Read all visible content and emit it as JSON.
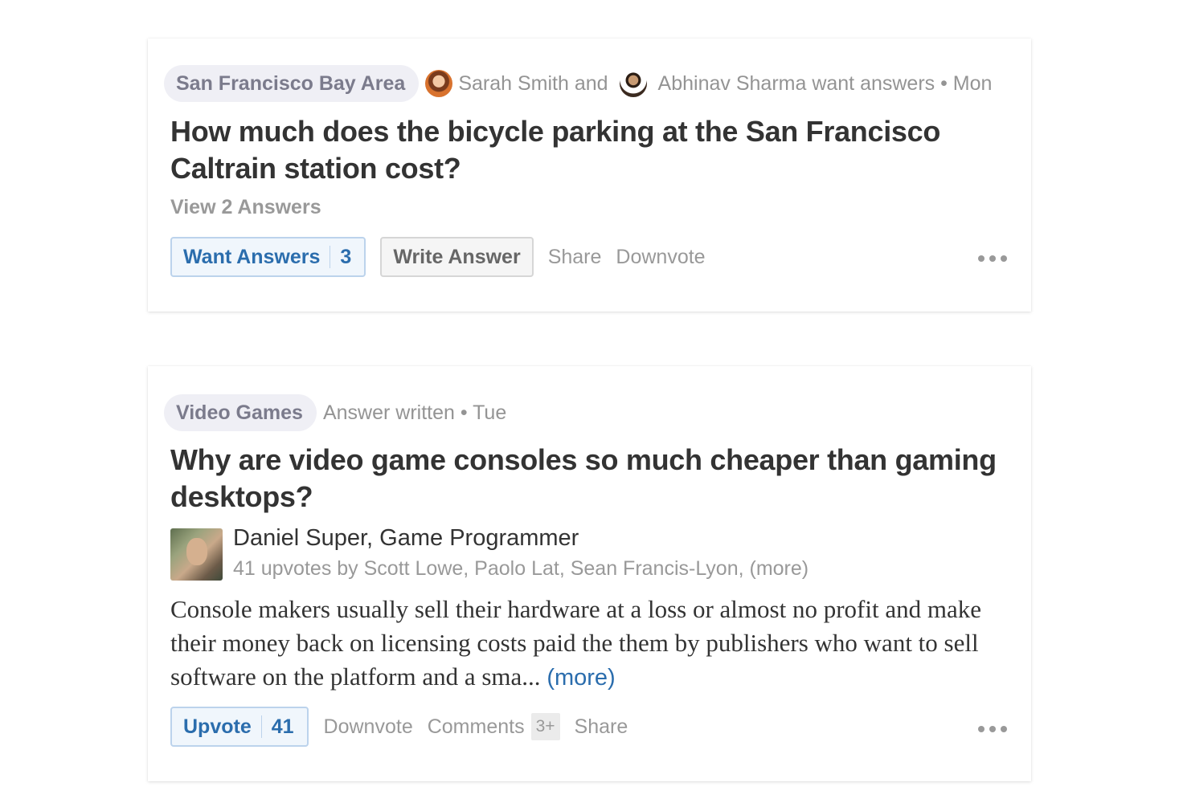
{
  "feed": {
    "question_card": {
      "topic": "San Francisco Bay Area",
      "asker_1": "Sarah Smith and",
      "asker_2_text": "Abhinav Sharma want answers • Mon",
      "title": "How much does the bicycle parking at the San Francisco Caltrain station cost?",
      "view_answers": "View 2 Answers",
      "want_answers_label": "Want Answers",
      "want_answers_count": "3",
      "write_answer_label": "Write Answer",
      "share_label": "Share",
      "downvote_label": "Downvote"
    },
    "answer_card": {
      "topic": "Video Games",
      "meta": "Answer written • Tue",
      "title": "Why are video game consoles so much cheaper than gaming desktops?",
      "author": "Daniel Super, Game Programmer",
      "upvotes_line": "41 upvotes by Scott Lowe, Paolo Lat, Sean Francis-Lyon, (more)",
      "answer_excerpt": "Console makers usually sell their hardware at a loss or almost no profit and make their money back on licensing costs paid the them by publishers who want to sell software on the platform and a sma...",
      "more_label": "(more)",
      "upvote_label": "Upvote",
      "upvote_count": "41",
      "downvote_label": "Downvote",
      "comments_label": "Comments",
      "comments_badge": "3+",
      "share_label": "Share"
    }
  },
  "colors": {
    "link_blue": "#2b6dad",
    "muted_grey": "#999999",
    "title_dark": "#333333",
    "pill_bg": "#efeff5"
  },
  "icons": {
    "overflow": "more-options-icon",
    "avatar": "user-avatar"
  }
}
